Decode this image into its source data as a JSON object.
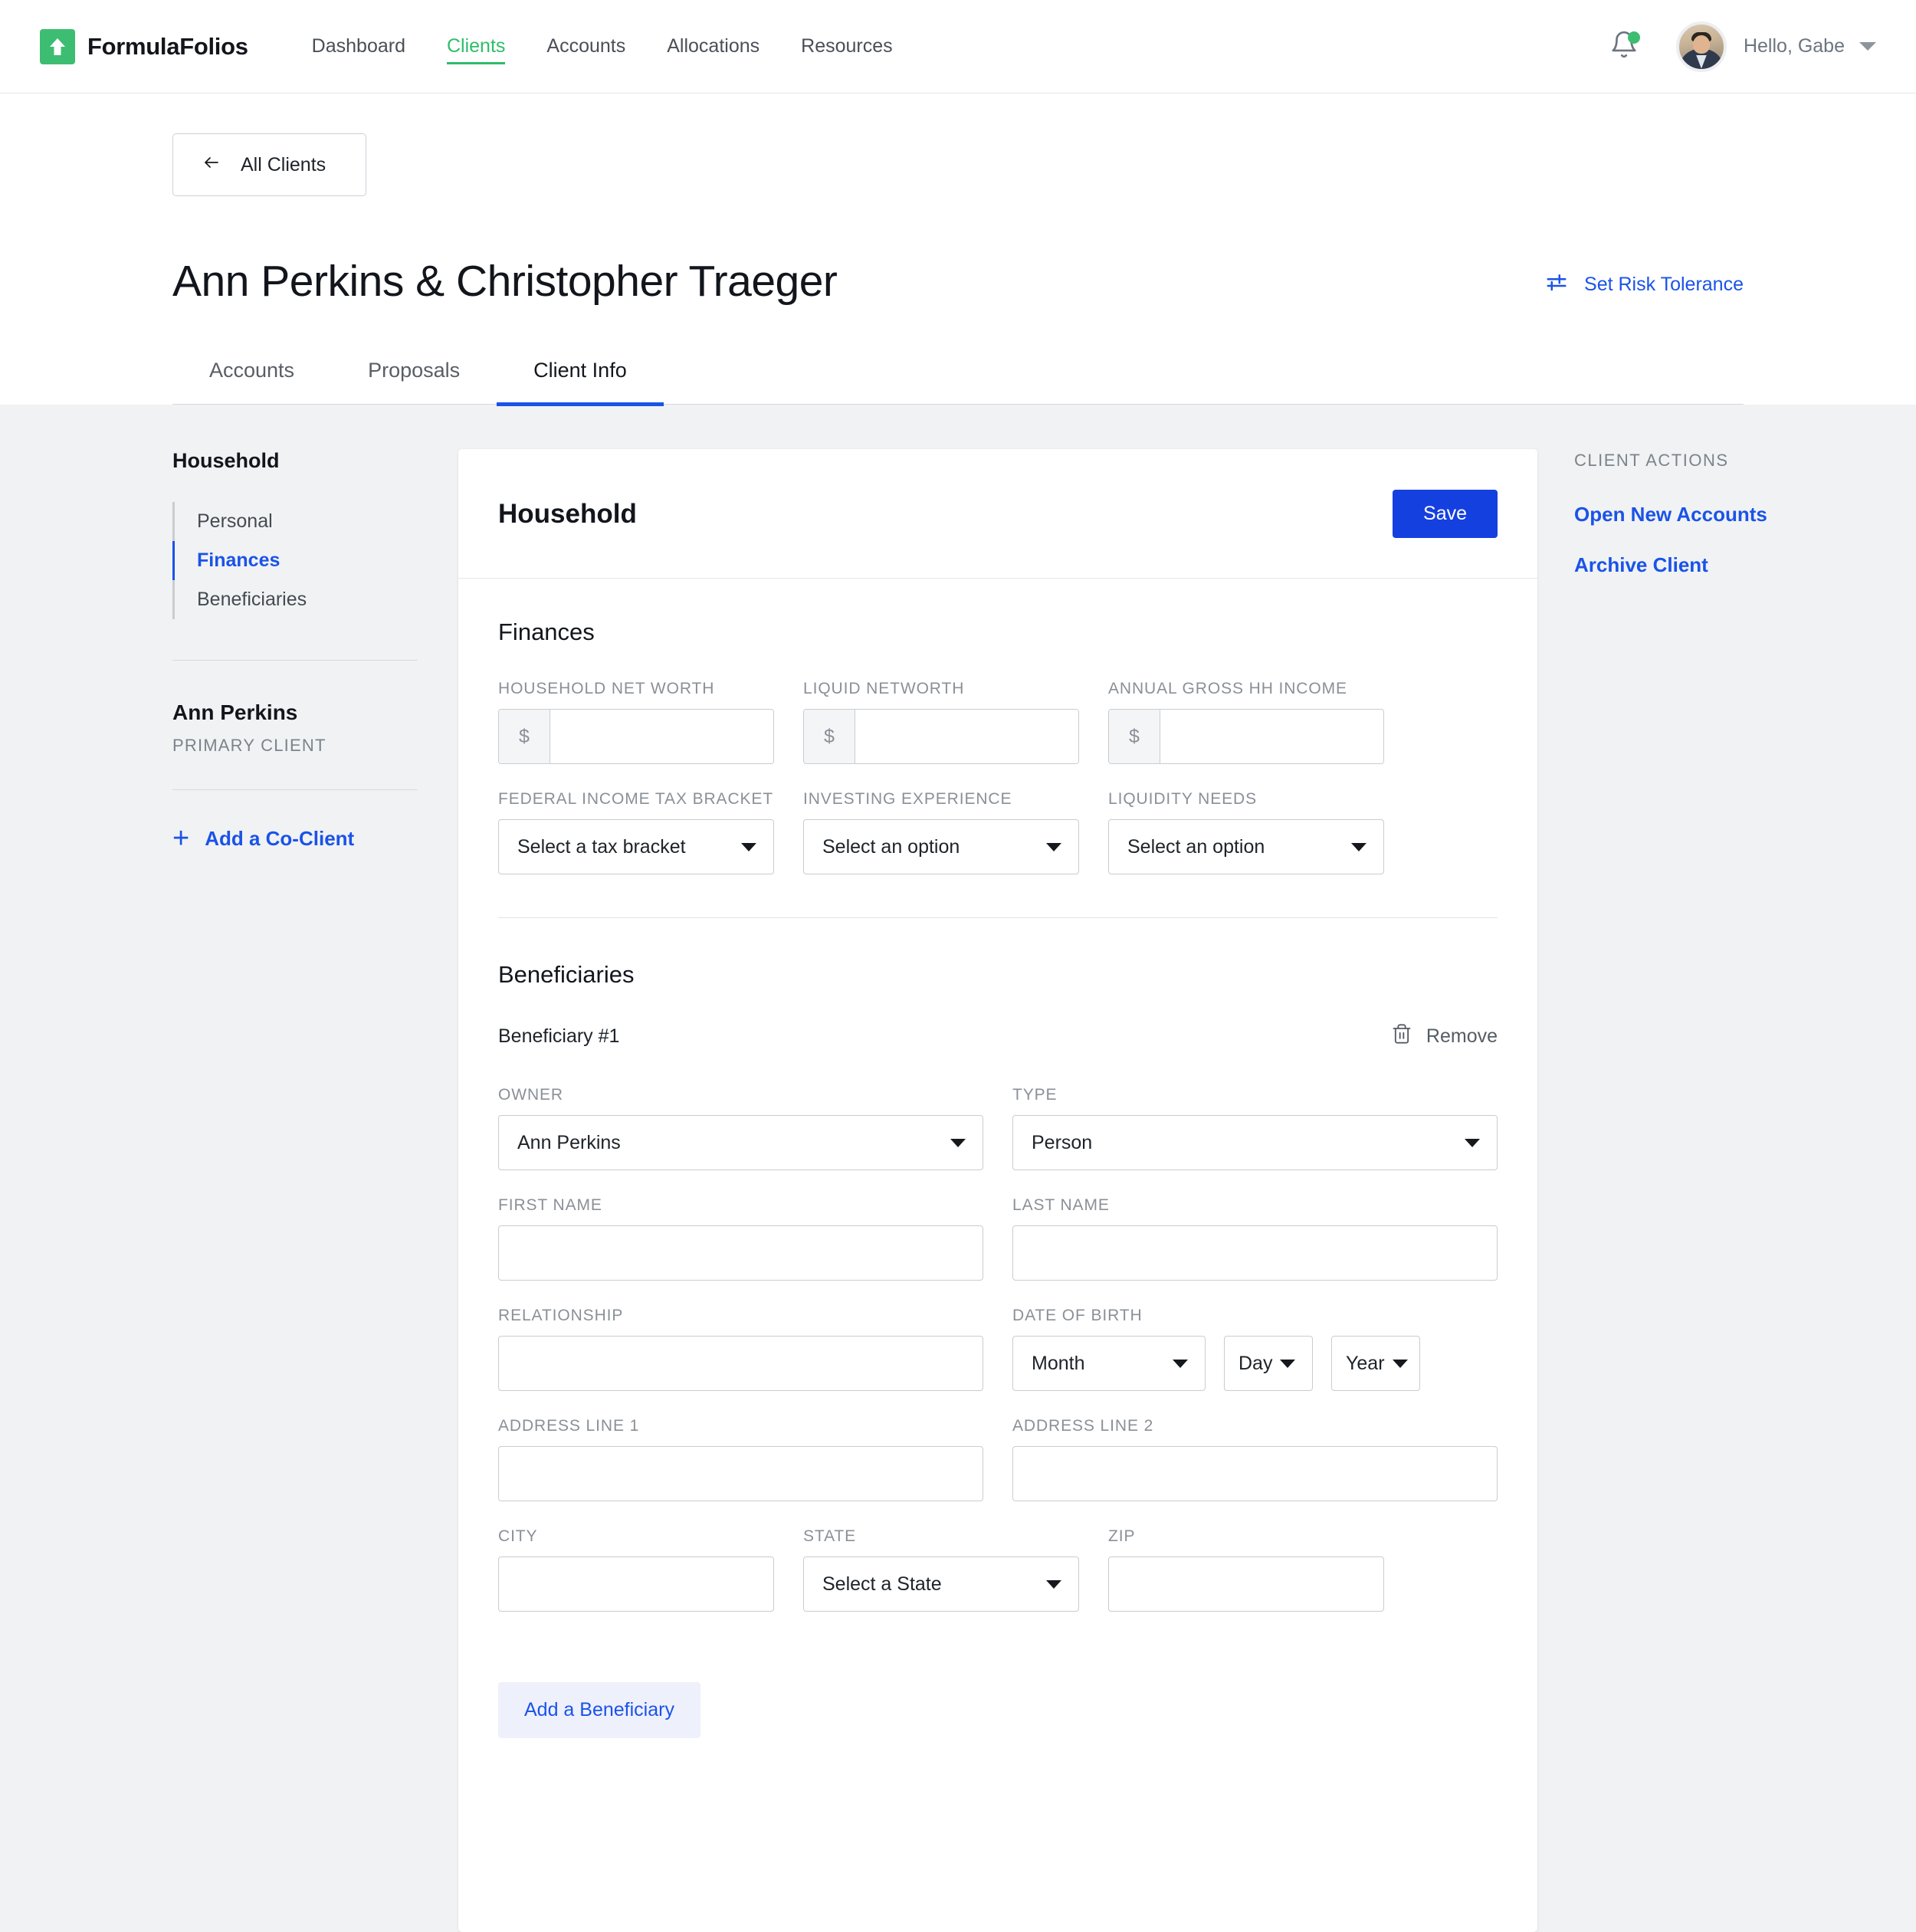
{
  "brand": {
    "name": "FormulaFolios",
    "logo_icon": "up-arrow-icon",
    "logo_color": "#3dbd72"
  },
  "nav": {
    "items": [
      {
        "label": "Dashboard",
        "active": false
      },
      {
        "label": "Clients",
        "active": true
      },
      {
        "label": "Accounts",
        "active": false
      },
      {
        "label": "Allocations",
        "active": false
      },
      {
        "label": "Resources",
        "active": false
      }
    ],
    "notification_icon": "bell-icon",
    "has_notification": true,
    "user_greeting": "Hello, Gabe",
    "user_caret_icon": "chevron-down-icon",
    "avatar_icon": "user-avatar"
  },
  "page": {
    "back_button": "All Clients",
    "back_icon": "arrow-left-icon",
    "title": "Ann Perkins & Christopher Traeger",
    "risk_link": "Set Risk Tolerance",
    "risk_icon": "tune-sliders-icon",
    "tabs": [
      {
        "label": "Accounts",
        "active": false
      },
      {
        "label": "Proposals",
        "active": false
      },
      {
        "label": "Client Info",
        "active": true
      }
    ]
  },
  "sidebar": {
    "heading": "Household",
    "items": [
      {
        "label": "Personal",
        "active": false
      },
      {
        "label": "Finances",
        "active": true
      },
      {
        "label": "Beneficiaries",
        "active": false
      }
    ],
    "client_name": "Ann Perkins",
    "client_role": "PRIMARY CLIENT",
    "add_co_client": "Add a Co-Client",
    "add_icon": "plus-icon"
  },
  "card": {
    "title": "Household",
    "save_label": "Save",
    "finances": {
      "heading": "Finances",
      "fields": [
        {
          "label": "HOUSEHOLD NET WORTH",
          "prefix": "$",
          "value": ""
        },
        {
          "label": "LIQUID NETWORTH",
          "prefix": "$",
          "value": ""
        },
        {
          "label": "ANNUAL GROSS HH INCOME",
          "prefix": "$",
          "value": ""
        }
      ],
      "selects": [
        {
          "label": "FEDERAL INCOME TAX BRACKET",
          "value": "Select a tax bracket"
        },
        {
          "label": "INVESTING EXPERIENCE",
          "value": "Select an option"
        },
        {
          "label": "LIQUIDITY NEEDS",
          "value": "Select an option"
        }
      ]
    },
    "beneficiaries": {
      "heading": "Beneficiaries",
      "item_label": "Beneficiary #1",
      "remove_label": "Remove",
      "remove_icon": "trash-icon",
      "owner_label": "OWNER",
      "owner_value": "Ann Perkins",
      "type_label": "TYPE",
      "type_value": "Person",
      "first_name_label": "FIRST NAME",
      "first_name_value": "",
      "last_name_label": "LAST NAME",
      "last_name_value": "",
      "relationship_label": "RELATIONSHIP",
      "relationship_value": "",
      "dob_label": "DATE OF BIRTH",
      "dob_month": "Month",
      "dob_day": "Day",
      "dob_year": "Year",
      "address1_label": "ADDRESS LINE 1",
      "address1_value": "",
      "address2_label": "ADDRESS LINE 2",
      "address2_value": "",
      "city_label": "CITY",
      "city_value": "",
      "state_label": "STATE",
      "state_value": "Select a State",
      "zip_label": "ZIP",
      "zip_value": "",
      "add_label": "Add a Beneficiary"
    }
  },
  "client_actions": {
    "title": "CLIENT ACTIONS",
    "links": [
      {
        "label": "Open New Accounts"
      },
      {
        "label": "Archive Client"
      }
    ]
  },
  "colors": {
    "brand_green": "#3dbd72",
    "accent_blue": "#1a53e8",
    "save_blue": "#1540e0",
    "body_gray": "#f1f2f3"
  }
}
